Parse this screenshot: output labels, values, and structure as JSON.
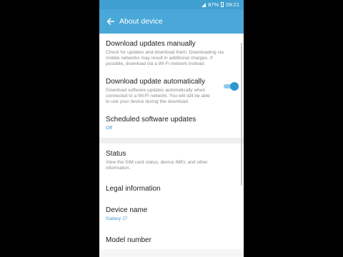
{
  "status_bar": {
    "battery": "87%",
    "time": "09:21"
  },
  "app_bar": {
    "title": "About device"
  },
  "items": [
    {
      "title": "Download updates manually",
      "description": "Check for updates and download them. Downloading via mobile networks may result in additional charges. If possible, download via a Wi-Fi network instead."
    },
    {
      "title": "Download update automatically",
      "description": "Download software updates automatically when connected to a Wi-Fi network. You will still be able to use your device during the download.",
      "toggle": "on"
    },
    {
      "title": "Scheduled software updates",
      "value": "Off"
    },
    {
      "title": "Status",
      "description": "View the SIM card status, device IMEI, and other information."
    },
    {
      "title": "Legal information"
    },
    {
      "title": "Device name",
      "value": "Galaxy J7"
    },
    {
      "title": "Model number"
    }
  ],
  "colors": {
    "accent": "#4aa8d8",
    "value_text": "#3a95cf"
  },
  "icons": {
    "back": "arrow-left-icon",
    "signal": "signal-icon"
  }
}
